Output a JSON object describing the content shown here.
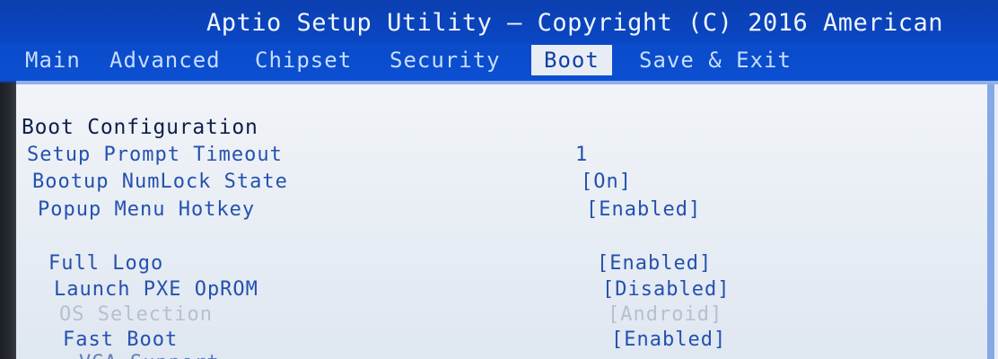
{
  "title": "Aptio Setup Utility – Copyright (C) 2016 American",
  "tabs": [
    {
      "label": "Main"
    },
    {
      "label": "Advanced"
    },
    {
      "label": "Chipset"
    },
    {
      "label": "Security"
    },
    {
      "label": "Boot"
    },
    {
      "label": "Save & Exit"
    }
  ],
  "active_tab": "Boot",
  "section_title": "Boot Configuration",
  "rows": [
    {
      "label": "Setup Prompt Timeout",
      "value": "1",
      "state": "enabled"
    },
    {
      "label": "Bootup NumLock State",
      "value": "[On]",
      "state": "enabled"
    },
    {
      "label": "Popup Menu Hotkey",
      "value": "[Enabled]",
      "state": "enabled"
    },
    {
      "label": "Full Logo",
      "value": "[Enabled]",
      "state": "enabled"
    },
    {
      "label": "Launch PXE OpROM",
      "value": "[Disabled]",
      "state": "enabled"
    },
    {
      "label": "OS Selection",
      "value": "[Android]",
      "state": "disabled"
    },
    {
      "label": "Fast Boot",
      "value": "[Enabled]",
      "state": "enabled"
    },
    {
      "label": "VGA Support",
      "value": "",
      "state": "partial"
    }
  ],
  "colors": {
    "header_blue": "#0b4fd2",
    "panel_bg": "#e8edf5",
    "item_text": "#2451ae",
    "disabled_text": "#b6c0cf"
  },
  "right_mark": "["
}
